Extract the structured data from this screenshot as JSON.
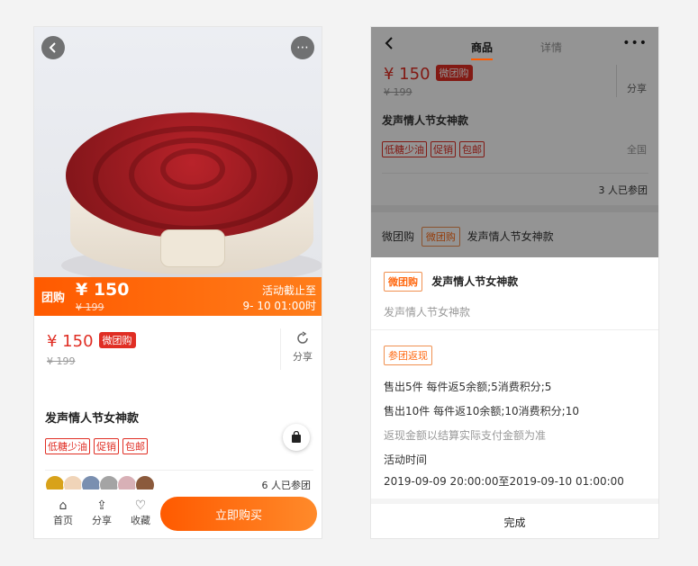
{
  "left": {
    "more_icon": "⋯",
    "promo": {
      "tag": "团购",
      "price": "¥ 150",
      "old_price": "¥ 199",
      "ends_label": "活动截止至",
      "ends_time": "9- 10 01:00时"
    },
    "price": "¥ 150",
    "badge": "微团购",
    "old_price": "¥ 199",
    "share_label": "分享",
    "title": "发声情人节女神款",
    "tags": [
      "低糖少油",
      "促销",
      "包邮"
    ],
    "joined": "6 人已参团",
    "tabbar": {
      "home": "首页",
      "share": "分享",
      "favorite": "收藏",
      "buy": "立即购买"
    }
  },
  "right": {
    "nav": {
      "tab_goods": "商品",
      "tab_detail": "详情"
    },
    "bg": {
      "price": "¥ 150",
      "badge": "微团购",
      "old_price": "¥ 199",
      "share": "分享",
      "title": "发声情人节女神款",
      "tags": [
        "低糖少油",
        "促销",
        "包邮"
      ],
      "region": "全国",
      "joined": "3 人已参团",
      "group_label": "微团购",
      "group_badge": "微团购",
      "group_title": "发声情人节女神款"
    },
    "sheet": {
      "badge": "微团购",
      "title": "发声情人节女神款",
      "subtitle": "发声情人节女神款",
      "rebate_badge": "参团返现",
      "rule1": "售出5件 每件返5余额;5消费积分;5",
      "rule2": "售出10件 每件返10余额;10消费积分;10",
      "note": "返现金额以结算实际支付金额为准",
      "time_label": "活动时间",
      "time_range": "2019-09-09 20:00:00至2019-09-10 01:00:00",
      "done": "完成"
    }
  },
  "colors": {
    "accent": "#ff5a00",
    "red": "#e02e24"
  }
}
